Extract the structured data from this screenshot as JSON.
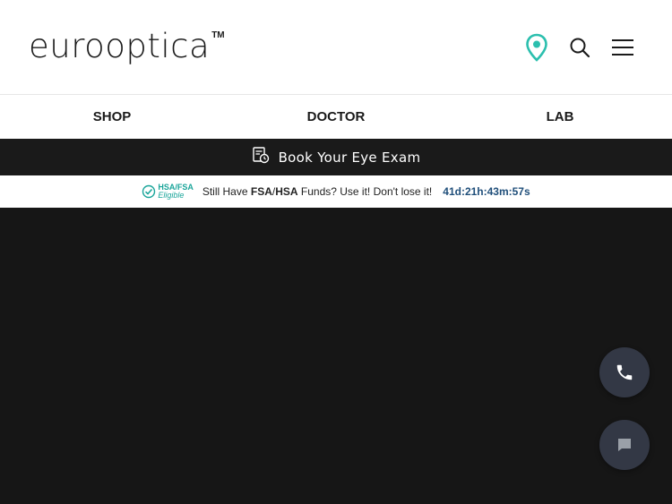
{
  "header": {
    "logo_text": "eurooptica",
    "logo_tm": "TM",
    "icons": [
      "location-pin-icon",
      "search-icon",
      "menu-icon"
    ],
    "accent_color": "#2bbfae"
  },
  "nav": {
    "items": [
      {
        "label": "SHOP"
      },
      {
        "label": "DOCTOR"
      },
      {
        "label": "LAB"
      }
    ]
  },
  "exam_bar": {
    "label": "Book Your Eye Exam",
    "icon": "calendar-clock-icon"
  },
  "fsa_bar": {
    "badge_top": "HSA/FSA",
    "badge_bottom": "Eligible",
    "msg_prefix": "Still Have ",
    "fsa": "FSA",
    "slash": "/",
    "hsa": "HSA",
    "msg_suffix": " Funds? Use it! Don't lose it!",
    "timer": "41d:21h:43m:57s"
  },
  "fabs": {
    "phone_icon": "phone-icon",
    "chat_icon": "chat-icon"
  }
}
